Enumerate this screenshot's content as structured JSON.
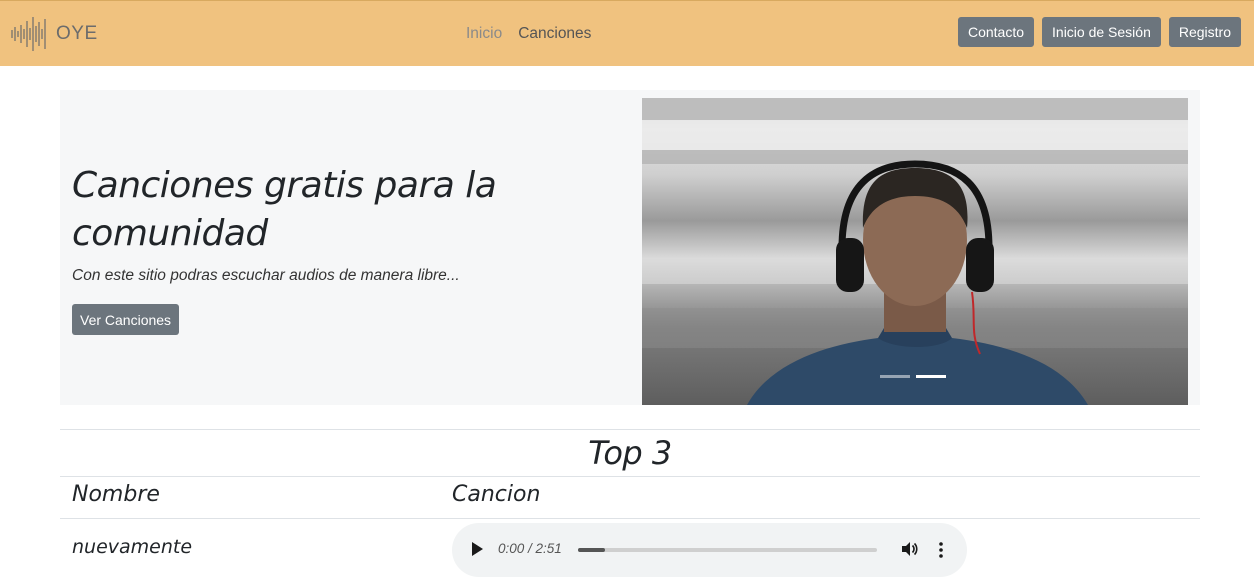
{
  "navbar": {
    "brand": "OYE",
    "links": [
      "Inicio",
      "Canciones"
    ],
    "buttons": [
      "Contacto",
      "Inicio de Sesión",
      "Registro"
    ]
  },
  "hero": {
    "title": "Canciones gratis para la comunidad",
    "subtitle": "Con este sitio podras escuchar audios de manera libre...",
    "button": "Ver Canciones"
  },
  "carousel": {
    "slide_count": 2,
    "active_index": 1
  },
  "table": {
    "caption": "Top 3",
    "columns": [
      "Nombre",
      "Cancion"
    ],
    "rows": [
      {
        "name": "nuevamente",
        "player": {
          "time": "0:00 / 2:51",
          "progress": 0.09
        }
      }
    ]
  },
  "colors": {
    "navbar_bg": "#f0c27f",
    "button_bg": "#6c757d",
    "hero_bg": "#f6f7f8"
  }
}
